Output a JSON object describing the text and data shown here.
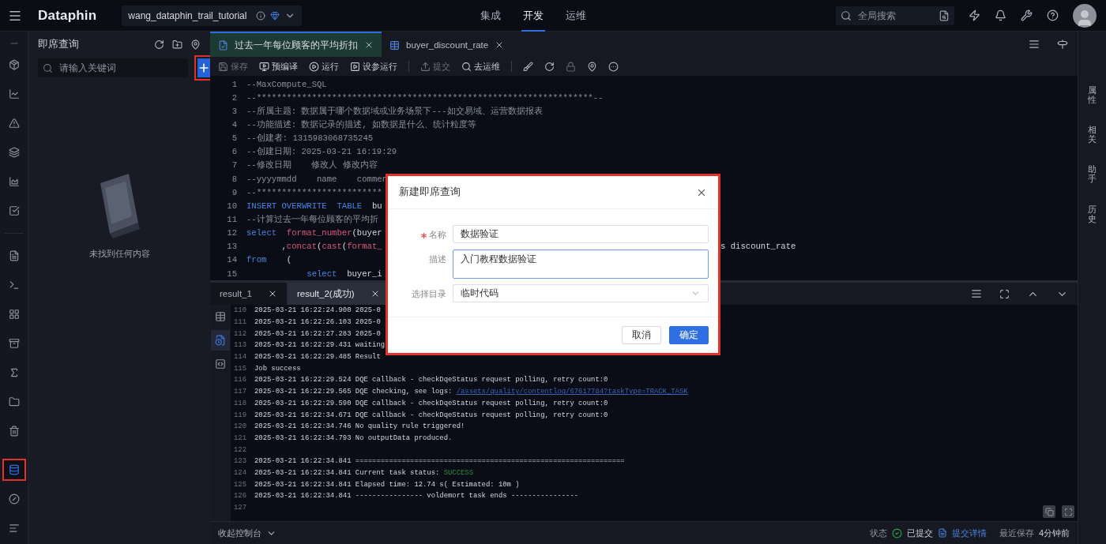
{
  "topbar": {
    "logo": "Dataphin",
    "project": "wang_dataphin_trail_tutorial",
    "nav": [
      {
        "label": "集成",
        "selected": false
      },
      {
        "label": "开发",
        "selected": true
      },
      {
        "label": "运维",
        "selected": false
      }
    ],
    "search": {
      "placeholder": "全局搜索"
    }
  },
  "left_rail": {
    "top": [
      {
        "selected": false
      },
      {
        "selected": false
      },
      {
        "selected": false
      },
      {
        "selected": false
      },
      {
        "selected": false
      },
      {
        "selected": false
      }
    ],
    "middle": [
      {
        "selected": false
      },
      {
        "selected": false
      },
      {
        "selected": false
      },
      {
        "selected": false
      },
      {
        "selected": false
      },
      {
        "selected": false
      },
      {
        "selected": false
      }
    ],
    "bottom": [
      {
        "selected": true,
        "highlighted": true
      },
      {
        "selected": false,
        "highlighted": false
      },
      {
        "selected": false,
        "highlighted": false
      }
    ]
  },
  "side_panel": {
    "title": "即席查询",
    "search": {
      "placeholder": "请输入关键词"
    },
    "add_button": {
      "highlighted": true
    },
    "empty_text": "未找到任何内容"
  },
  "editor_tabs": [
    {
      "label": "过去一年每位顾客的平均折扣",
      "kind": "query",
      "selected": true
    },
    {
      "label": "buyer_discount_rate",
      "kind": "table",
      "selected": false
    }
  ],
  "toolbar": [
    {
      "label": "保存",
      "disabled": true
    },
    {
      "label": "预编译",
      "disabled": false
    },
    {
      "label": "运行",
      "disabled": false
    },
    {
      "label": "设参运行",
      "disabled": false
    },
    {
      "label": "提交",
      "disabled": true
    },
    {
      "label": "去运维",
      "disabled": false
    }
  ],
  "code_lines": [
    {
      "number": "1",
      "segments": [
        {
          "kind": "comment",
          "text": "--MaxCompute_SQL"
        }
      ]
    },
    {
      "number": "2",
      "segments": [
        {
          "kind": "comment",
          "text": "--*******************************************************************--"
        }
      ]
    },
    {
      "number": "3",
      "segments": [
        {
          "kind": "comment",
          "text": "--所属主题: 数据属于哪个数据域或业务场景下---如交易域、运营数据报表"
        }
      ]
    },
    {
      "number": "4",
      "segments": [
        {
          "kind": "comment",
          "text": "--功能描述: 数据记录的描述, 如数据是什么、统计粒度等"
        }
      ]
    },
    {
      "number": "5",
      "segments": [
        {
          "kind": "comment",
          "text": "--创建者: 1315983068735245"
        }
      ]
    },
    {
      "number": "6",
      "segments": [
        {
          "kind": "comment",
          "text": "--创建日期: 2025-03-21 16:19:29"
        }
      ]
    },
    {
      "number": "7",
      "segments": [
        {
          "kind": "comment",
          "text": "--修改日期    修改人 修改内容"
        }
      ]
    },
    {
      "number": "8",
      "segments": [
        {
          "kind": "comment",
          "text": "--yyyymmdd    name    commen"
        }
      ]
    },
    {
      "number": "9",
      "segments": [
        {
          "kind": "comment",
          "text": "--*************************"
        }
      ]
    },
    {
      "number": "10",
      "segments": [
        {
          "kind": "keyword",
          "text": "INSERT OVERWRITE  TABLE"
        },
        {
          "kind": "plain",
          "text": "  bu"
        }
      ]
    },
    {
      "number": "11",
      "segments": [
        {
          "kind": "comment",
          "text": "--计算过去一年每位顾客的平均折"
        }
      ]
    },
    {
      "number": "12",
      "segments": [
        {
          "kind": "keyword",
          "text": "select  "
        },
        {
          "kind": "func",
          "text": "format_number"
        },
        {
          "kind": "plain",
          "text": "(buyer"
        }
      ]
    },
    {
      "number": "13",
      "segments": [
        {
          "kind": "plain",
          "text": "       ,"
        },
        {
          "kind": "func",
          "text": "concat"
        },
        {
          "kind": "plain",
          "text": "("
        },
        {
          "kind": "func",
          "text": "cast"
        },
        {
          "kind": "plain",
          "text": "("
        },
        {
          "kind": "func",
          "text": "format_"
        }
      ],
      "tail": "s discount_rate"
    },
    {
      "number": "14",
      "segments": [
        {
          "kind": "keyword",
          "text": "from"
        },
        {
          "kind": "plain",
          "text": "    ("
        }
      ]
    },
    {
      "number": "15",
      "segments": [
        {
          "kind": "keyword",
          "text": "            select"
        },
        {
          "kind": "plain",
          "text": "  buyer_i"
        }
      ]
    }
  ],
  "result_tabs": [
    {
      "label": "result_1",
      "selected": false
    },
    {
      "label": "result_2(成功)",
      "selected": true
    }
  ],
  "result_views": [
    {
      "selected": false
    },
    {
      "selected": true
    },
    {
      "selected": false
    }
  ],
  "log_lines": [
    {
      "number": "110",
      "segments": [
        {
          "kind": "plain",
          "text": "2025-03-21 16:22:24.900 2025-0"
        }
      ]
    },
    {
      "number": "111",
      "segments": [
        {
          "kind": "plain",
          "text": "2025-03-21 16:22:26.103 2025-0"
        }
      ]
    },
    {
      "number": "112",
      "segments": [
        {
          "kind": "plain",
          "text": "2025-03-21 16:22:27.283 2025-0"
        }
      ]
    },
    {
      "number": "113",
      "segments": [
        {
          "kind": "plain",
          "text": "2025-03-21 16:22:29.431 waiting"
        }
      ]
    },
    {
      "number": "114",
      "segments": [
        {
          "kind": "plain",
          "text": "2025-03-21 16:22:29.485 Result"
        }
      ]
    },
    {
      "number": "115",
      "segments": [
        {
          "kind": "plain",
          "text": "Job success"
        }
      ]
    },
    {
      "number": "116",
      "segments": [
        {
          "kind": "plain",
          "text": "2025-03-21 16:22:29.524 DQE callback - checkDqeStatus request polling, retry count:0"
        }
      ]
    },
    {
      "number": "117",
      "segments": [
        {
          "kind": "plain",
          "text": "2025-03-21 16:22:29.565 DQE checking, see logs: "
        },
        {
          "kind": "link",
          "text": "/assets/quality/contentlog/67617784?taskType=TRACK_TASK"
        }
      ]
    },
    {
      "number": "118",
      "segments": [
        {
          "kind": "plain",
          "text": "2025-03-21 16:22:29.590 DQE callback - checkDqeStatus request polling, retry count:0"
        }
      ]
    },
    {
      "number": "119",
      "segments": [
        {
          "kind": "plain",
          "text": "2025-03-21 16:22:34.671 DQE callback - checkDqeStatus request polling, retry count:0"
        }
      ]
    },
    {
      "number": "120",
      "segments": [
        {
          "kind": "plain",
          "text": "2025-03-21 16:22:34.746 No quality rule triggered!"
        }
      ]
    },
    {
      "number": "121",
      "segments": [
        {
          "kind": "plain",
          "text": "2025-03-21 16:22:34.793 No outputData produced."
        }
      ]
    },
    {
      "number": "122"
    },
    {
      "number": "123",
      "segments": [
        {
          "kind": "plain",
          "text": "2025-03-21 16:22:34.841 ================================================================"
        }
      ]
    },
    {
      "number": "124",
      "segments": [
        {
          "kind": "plain",
          "text": "2025-03-21 16:22:34.841 Current task status: "
        },
        {
          "kind": "success",
          "text": "SUCCESS"
        }
      ]
    },
    {
      "number": "125",
      "segments": [
        {
          "kind": "plain",
          "text": "2025-03-21 16:22:34.841 Elapsed time: 12.74 s( Estimated: 10m )"
        }
      ]
    },
    {
      "number": "126",
      "segments": [
        {
          "kind": "plain",
          "text": "2025-03-21 16:22:34.841 ---------------- voldemort task ends ----------------"
        }
      ]
    },
    {
      "number": "127"
    }
  ],
  "status_bar": {
    "collapse": "收起控制台",
    "items": [
      {
        "kind": "label",
        "text": "状态"
      },
      {
        "kind": "status",
        "text": "已提交"
      },
      {
        "kind": "link",
        "text": "提交详情"
      },
      {
        "kind": "label",
        "text": "最近保存"
      },
      {
        "kind": "value",
        "text": "4分钟前"
      }
    ]
  },
  "right_rail": [
    "属性",
    "相关",
    "助手",
    "历史"
  ],
  "dialog": {
    "title": "新建即席查询",
    "highlighted": true,
    "fields": [
      {
        "kind": "input",
        "label": "名称",
        "required": true,
        "value": "数据验证",
        "focused": false
      },
      {
        "kind": "textarea",
        "label": "描述",
        "required": false,
        "value": "入门教程数据验证",
        "focused": true
      },
      {
        "kind": "select",
        "label": "选择目录",
        "required": false,
        "value": "临时代码",
        "focused": false
      }
    ],
    "buttons": [
      {
        "label": "取消",
        "primary": false
      },
      {
        "label": "确定",
        "primary": true
      }
    ]
  }
}
